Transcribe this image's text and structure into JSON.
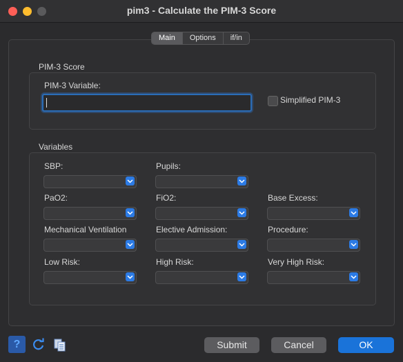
{
  "window": {
    "title": "pim3 - Calculate the PIM-3 Score"
  },
  "tabs": [
    {
      "label": "Main",
      "active": true
    },
    {
      "label": "Options",
      "active": false
    },
    {
      "label": "if/in",
      "active": false
    }
  ],
  "score_section": {
    "title": "PIM-3 Score",
    "variable_label": "PIM-3 Variable:",
    "variable_value": "",
    "simplified_label": "Simplified PIM-3",
    "simplified_checked": false
  },
  "variables_section": {
    "title": "Variables",
    "fields": {
      "sbp": "SBP:",
      "pupils": "Pupils:",
      "pao2": "PaO2:",
      "fio2": "FiO2:",
      "base_excess": "Base Excess:",
      "mech_vent": "Mechanical Ventilation",
      "elective": "Elective Admission:",
      "procedure": "Procedure:",
      "low_risk": "Low Risk:",
      "high_risk": "High Risk:",
      "very_high_risk": "Very High Risk:"
    }
  },
  "buttons": {
    "help": "?",
    "submit": "Submit",
    "cancel": "Cancel",
    "ok": "OK"
  },
  "icons": [
    "help-icon",
    "reset-icon",
    "copy-icon",
    "chevron-down-icon"
  ],
  "colors": {
    "accent": "#1a73d9",
    "dropdown_arrow": "#2c7be5"
  }
}
